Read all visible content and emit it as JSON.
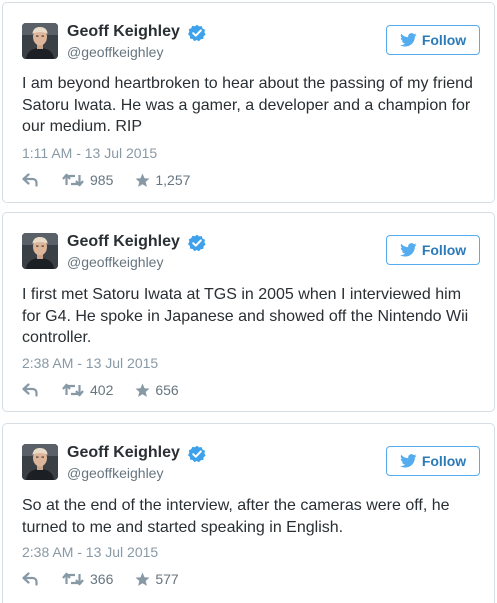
{
  "colors": {
    "twitter_blue": "#55acee",
    "follow_text": "#2b7bb9",
    "name_text": "#292f33",
    "meta_text": "#8899a6",
    "verified_badge": "#3ea1ec"
  },
  "icons": {
    "follow": "twitter-bird-icon",
    "verified": "verified-badge-icon",
    "reply": "reply-arrow-icon",
    "retweet": "retweet-arrows-icon",
    "favorite": "star-icon"
  },
  "tweets": [
    {
      "author": "Geoff Keighley",
      "handle": "@geoffkeighley",
      "follow_label": "Follow",
      "text": "I am beyond heartbroken to hear about the passing of my friend Satoru Iwata. He was a gamer, a developer and a champion for our medium. RIP",
      "timestamp": "1:11 AM - 13 Jul 2015",
      "retweets": "985",
      "favorites": "1,257"
    },
    {
      "author": "Geoff Keighley",
      "handle": "@geoffkeighley",
      "follow_label": "Follow",
      "text": "I first met Satoru Iwata at TGS in 2005 when I interviewed him for G4. He spoke in Japanese and showed off the Nintendo Wii controller.",
      "timestamp": "2:38 AM - 13 Jul 2015",
      "retweets": "402",
      "favorites": "656"
    },
    {
      "author": "Geoff Keighley",
      "handle": "@geoffkeighley",
      "follow_label": "Follow",
      "text": "So at the end of the interview, after the cameras were off, he turned to me and started speaking in English.",
      "timestamp": "2:38 AM - 13 Jul 2015",
      "retweets": "366",
      "favorites": "577"
    }
  ]
}
